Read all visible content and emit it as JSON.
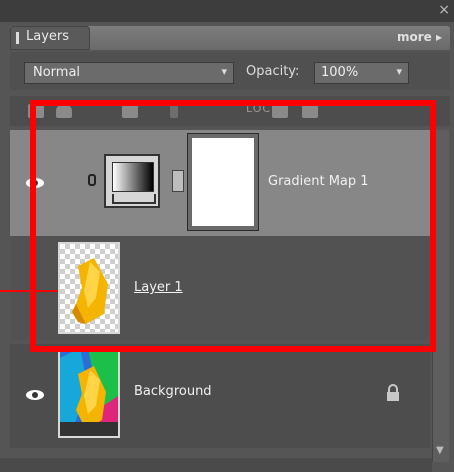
{
  "panel": {
    "tab_label": "Layers",
    "more_label": "more",
    "more_arrow": "▸",
    "close_glyph": "×"
  },
  "toolbar": {
    "blend_mode": "Normal",
    "opacity_label": "Opacity:",
    "opacity_value": "100%",
    "dropdown_glyph": "▾"
  },
  "layer_tools": {
    "lock_label": "LOCK:"
  },
  "layers": [
    {
      "name": "Gradient Map 1",
      "type": "adjustment",
      "visible": true,
      "selected": true
    },
    {
      "name": "Layer 1",
      "type": "pixel",
      "visible": false,
      "selected": false
    },
    {
      "name": "Background",
      "type": "background",
      "visible": true,
      "locked": true
    }
  ],
  "colors": {
    "highlight": "#ff0000",
    "panel_bg": "#555555",
    "selected_row": "#878787"
  }
}
